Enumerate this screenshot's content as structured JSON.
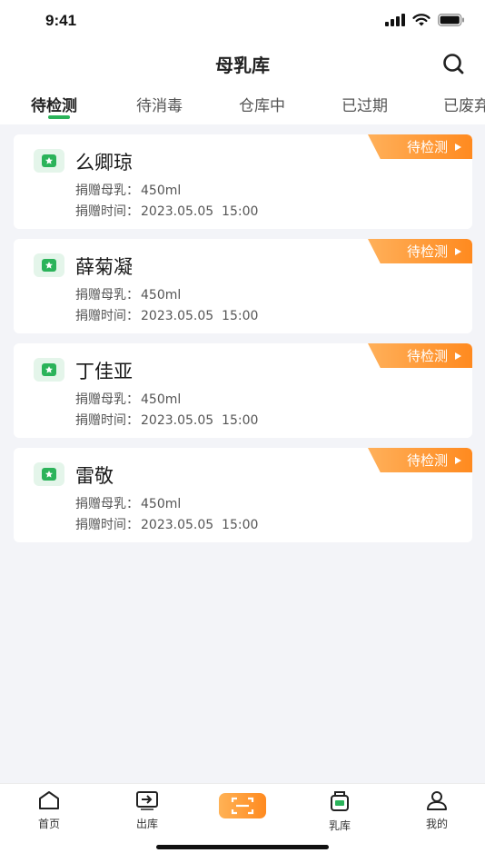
{
  "status_bar": {
    "time": "9:41"
  },
  "header": {
    "title": "母乳库",
    "search_icon": "search-icon"
  },
  "tabs": [
    {
      "label": "待检测",
      "active": true
    },
    {
      "label": "待消毒",
      "active": false
    },
    {
      "label": "仓库中",
      "active": false
    },
    {
      "label": "已过期",
      "active": false
    },
    {
      "label": "已废弃",
      "active": false
    }
  ],
  "cards": [
    {
      "name": "么卿琼",
      "status": "待检测",
      "amount_label": "捐赠母乳：",
      "amount": "450ml",
      "time_label": "捐赠时间：",
      "time": "2023.05.05  15:00"
    },
    {
      "name": "薛菊凝",
      "status": "待检测",
      "amount_label": "捐赠母乳：",
      "amount": "450ml",
      "time_label": "捐赠时间：",
      "time": "2023.05.05  15:00"
    },
    {
      "name": "丁佳亚",
      "status": "待检测",
      "amount_label": "捐赠母乳：",
      "amount": "450ml",
      "time_label": "捐赠时间：",
      "time": "2023.05.05  15:00"
    },
    {
      "name": "雷敬",
      "status": "待检测",
      "amount_label": "捐赠母乳：",
      "amount": "450ml",
      "time_label": "捐赠时间：",
      "time": "2023.05.05  15:00"
    }
  ],
  "tabbar": {
    "home": "首页",
    "out": "出库",
    "scan_icon": "scan-icon",
    "library": "乳库",
    "mine": "我的"
  },
  "colors": {
    "accent_green": "#2bb35a",
    "badge_orange": "#ff8a1f"
  }
}
